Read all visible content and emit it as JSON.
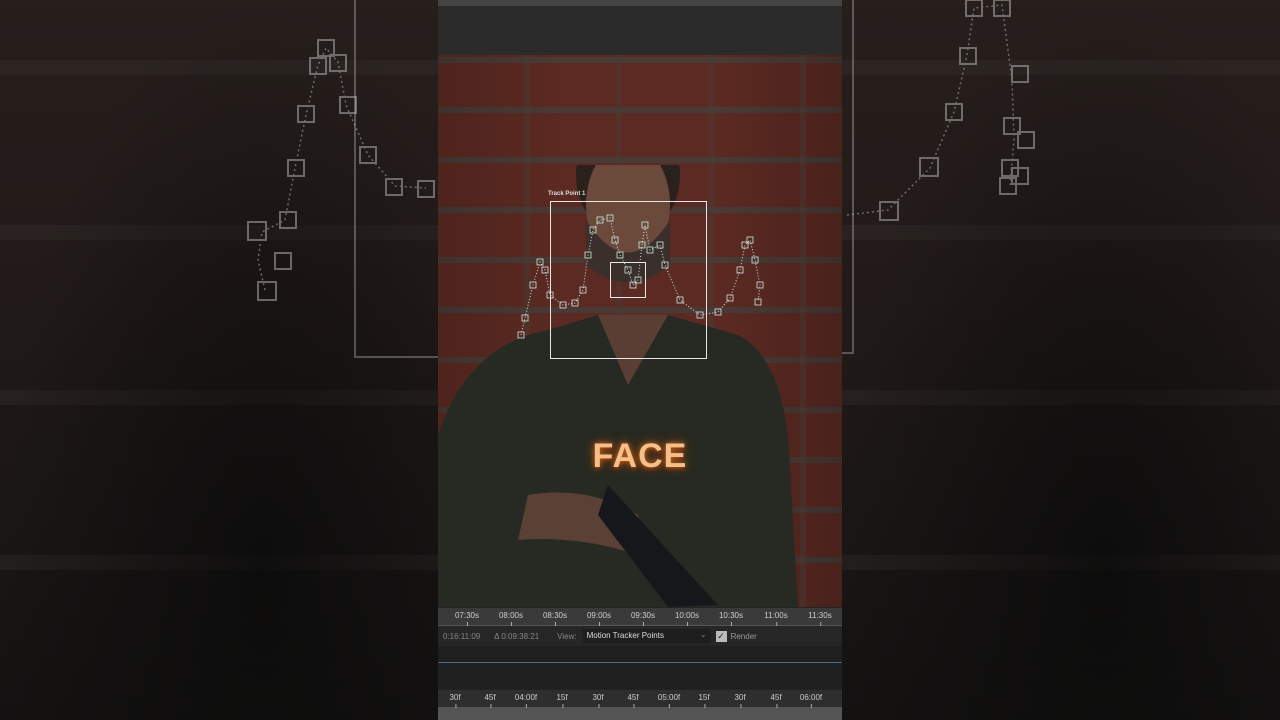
{
  "tracker": {
    "label": "Track Point 1"
  },
  "overlay": {
    "caption": "FACE"
  },
  "timeline": {
    "top_ruler": [
      "07:30s",
      "08:00s",
      "08:30s",
      "09:00s",
      "09:30s",
      "10:00s",
      "10:30s",
      "11:00s",
      "11:30s"
    ],
    "current_time": "0:16:11:09",
    "delta_time": "Δ 0:09:38:21",
    "view_label": "View:",
    "view_value": "Motion Tracker Points",
    "render_label": "Render",
    "render_checked": true,
    "bottom_ruler": [
      "30f",
      "45f",
      "04:00f",
      "15f",
      "30f",
      "45f",
      "05:00f",
      "15f",
      "30f",
      "45f",
      "06:00f"
    ]
  },
  "colors": {
    "track_path": "#cfe8e0",
    "caption": "#f4c08a"
  }
}
